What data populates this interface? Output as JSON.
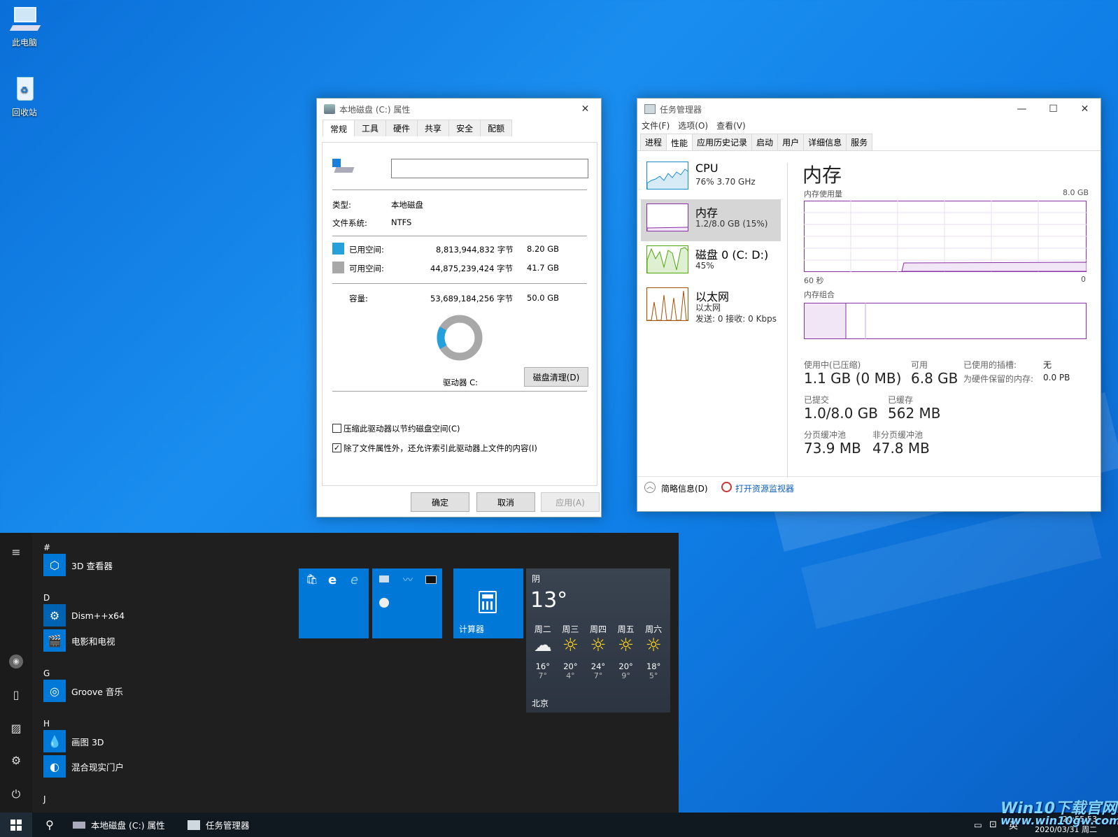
{
  "desktop": {
    "icons": [
      {
        "label": "此电脑",
        "icon": "computer-icon"
      },
      {
        "label": "回收站",
        "icon": "recycle-bin-icon"
      }
    ]
  },
  "props": {
    "title": "本地磁盘 (C:) 属性",
    "close": "✕",
    "tabs": [
      "常规",
      "工具",
      "硬件",
      "共享",
      "安全",
      "配额"
    ],
    "name_value": "",
    "type_label": "类型:",
    "type_value": "本地磁盘",
    "fs_label": "文件系统:",
    "fs_value": "NTFS",
    "used_label": "已用空间:",
    "used_bytes": "8,813,944,832 字节",
    "used_gb": "8.20 GB",
    "free_label": "可用空间:",
    "free_bytes": "44,875,239,424 字节",
    "free_gb": "41.7 GB",
    "cap_label": "容量:",
    "cap_bytes": "53,689,184,256 字节",
    "cap_gb": "50.0 GB",
    "drive_label": "驱动器 C:",
    "cleanup": "磁盘清理(D)",
    "compress": "压缩此驱动器以节约磁盘空间(C)",
    "index": "除了文件属性外，还允许索引此驱动器上文件的内容(I)",
    "ok": "确定",
    "cancel": "取消",
    "apply": "应用(A)",
    "used_fraction": 0.164,
    "colors": {
      "used": "#26a0da",
      "free": "#a8a8a8"
    }
  },
  "taskmgr": {
    "title": "任务管理器",
    "min": "—",
    "max": "☐",
    "close": "✕",
    "menu": [
      "文件(F)",
      "选项(O)",
      "查看(V)"
    ],
    "tabs": [
      "进程",
      "性能",
      "应用历史记录",
      "启动",
      "用户",
      "详细信息",
      "服务"
    ],
    "perf": [
      {
        "name": "CPU",
        "sub1": "76% 3.70 GHz",
        "sub2": ""
      },
      {
        "name": "内存",
        "sub1": "1.2/8.0 GB (15%)",
        "sub2": ""
      },
      {
        "name": "磁盘 0 (C: D:)",
        "sub1": "45%",
        "sub2": ""
      },
      {
        "name": "以太网",
        "sub1": "以太网",
        "sub2": "发送: 0 接收: 0 Kbps"
      }
    ],
    "heading": "内存",
    "usage_label": "内存使用量",
    "usage_max": "8.0 GB",
    "axis_left": "60 秒",
    "axis_right": "0",
    "composition": "内存组合",
    "stats": {
      "inuse_l": "使用中(已压缩)",
      "inuse_v": "1.1 GB (0 MB)",
      "avail_l": "可用",
      "avail_v": "6.8 GB",
      "slots_l": "已使用的插槽:",
      "slots_v": "无",
      "reserved_l": "为硬件保留的内存:",
      "reserved_v": "0.0 PB",
      "commit_l": "已提交",
      "commit_v": "1.0/8.0 GB",
      "cached_l": "已缓存",
      "cached_v": "562 MB",
      "paged_l": "分页缓冲池",
      "paged_v": "73.9 MB",
      "nonpaged_l": "非分页缓冲池",
      "nonpaged_v": "47.8 MB"
    },
    "fewer": "简略信息(D)",
    "resmon": "打开资源监视器",
    "accent": "#8b2fa6"
  },
  "start": {
    "rail": [
      "hamburger-icon",
      "user-icon",
      "document-icon",
      "pictures-icon",
      "settings-icon",
      "power-icon"
    ],
    "groups": [
      {
        "letter": "#",
        "apps": [
          {
            "name": "3D 查看器",
            "icon": "cube-icon"
          }
        ]
      },
      {
        "letter": "D",
        "apps": [
          {
            "name": "Dism++x64",
            "icon": "gear-icon"
          },
          {
            "name": "电影和电视",
            "icon": "clapper-icon"
          }
        ]
      },
      {
        "letter": "G",
        "apps": [
          {
            "name": "Groove 音乐",
            "icon": "music-disc-icon"
          }
        ]
      },
      {
        "letter": "H",
        "apps": [
          {
            "name": "画图 3D",
            "icon": "paint-drop-icon"
          },
          {
            "name": "混合现实门户",
            "icon": "headset-icon"
          }
        ]
      },
      {
        "letter": "J",
        "apps": []
      }
    ],
    "calc_label": "计算器",
    "weather": {
      "cond": "阴",
      "temp": "13°",
      "city": "北京",
      "days": [
        {
          "d": "周二",
          "hi": "16°",
          "lo": "7°",
          "icon": "cloud-icon"
        },
        {
          "d": "周三",
          "hi": "20°",
          "lo": "4°",
          "icon": "sun-icon"
        },
        {
          "d": "周四",
          "hi": "24°",
          "lo": "7°",
          "icon": "sun-icon"
        },
        {
          "d": "周五",
          "hi": "20°",
          "lo": "9°",
          "icon": "sun-icon"
        },
        {
          "d": "周六",
          "hi": "18°",
          "lo": "5°",
          "icon": "sun-icon"
        }
      ]
    }
  },
  "taskbar": {
    "items": [
      "本地磁盘 (C:) 属性",
      "任务管理器"
    ],
    "ime": "英",
    "time": "20:55:53",
    "date": "2020/03/31 周二",
    "watermark": "Win10下载官网",
    "watermark_url": "www.win10gw.com"
  }
}
